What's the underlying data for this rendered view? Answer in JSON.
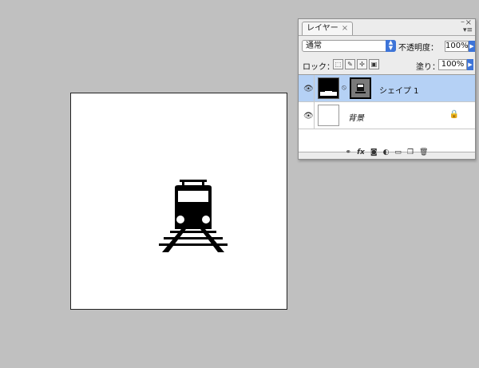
{
  "canvas": {
    "background": "#ffffff",
    "shape_color": "#000000"
  },
  "layers_panel": {
    "tab_label": "レイヤー",
    "tab_close": "×",
    "close_symbol": "×",
    "minimize_symbol": "–",
    "menu_symbol": "▾≡",
    "blend_mode": "通常",
    "opacity_label": "不透明度：",
    "opacity_value": "100%",
    "lock_label": "ロック：",
    "fill_label": "塗り：",
    "fill_value": "100%",
    "layers": [
      {
        "name": "シェイプ 1",
        "selected": true
      },
      {
        "name": "背景",
        "selected": false
      }
    ],
    "accent_color": "#3d74d8",
    "selection_color": "#b5d1f5"
  }
}
